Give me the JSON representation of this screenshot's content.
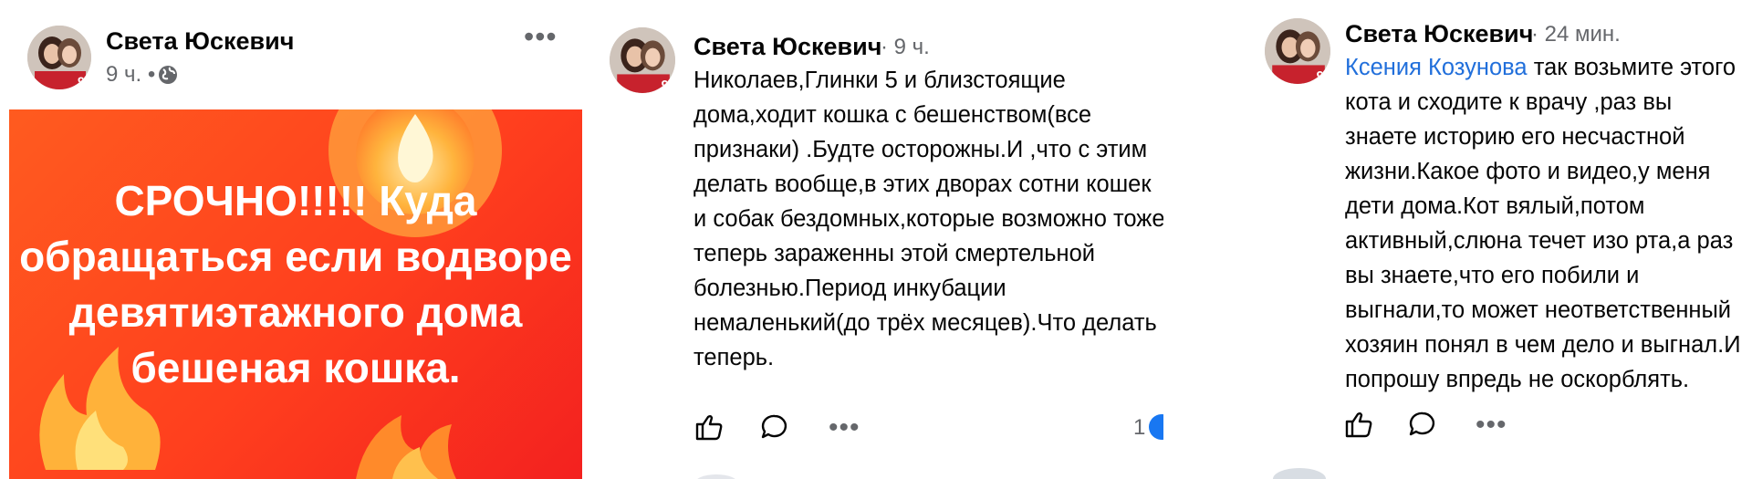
{
  "post": {
    "author": "Света Юскевич",
    "time": "9 ч. •",
    "image_text": "СРОЧНО!!!!! Куда обращаться если водворе девятиэтажного дома бешеная кошка."
  },
  "comment1": {
    "author": "Света Юскевич",
    "time": "· 9 ч.",
    "text": "Николаев,Глинки 5 и близстоящие дома,ходит кошка с бешенством(все признаки) .Будте осторожны.И ,что с этим делать вообще,в этих дворах сотни кошек и собак бездомных,которые возможно тоже теперь зараженны этой смертельной болезнью.Период инкубации немаленький(до трёх месяцев).Что делать теперь.",
    "reaction_count": "1"
  },
  "comment2": {
    "author": "Света Юскевич",
    "time": "· 24 мин.",
    "mention": "Ксения Козунова",
    "text": " так возьмите этого кота и  сходите к врачу ,раз вы знаете историю его несчастной жизни.Какое фото и видео,у меня дети дома.Кот вялый,потом активный,слюна течет изо рта,а раз вы знаете,что его побили и выгнали,то может неответственный хозяин понял в чем дело и выгнал.И попрошу впредь не оскорблять."
  },
  "icons": {
    "like": "thumbs-up-icon",
    "comment": "speech-bubble-icon",
    "more": "more-dots-icon",
    "privacy": "globe-icon"
  },
  "colors": {
    "mention": "#216fdb",
    "image_bg": "#ff4a1f",
    "secondary_text": "#65676b"
  }
}
